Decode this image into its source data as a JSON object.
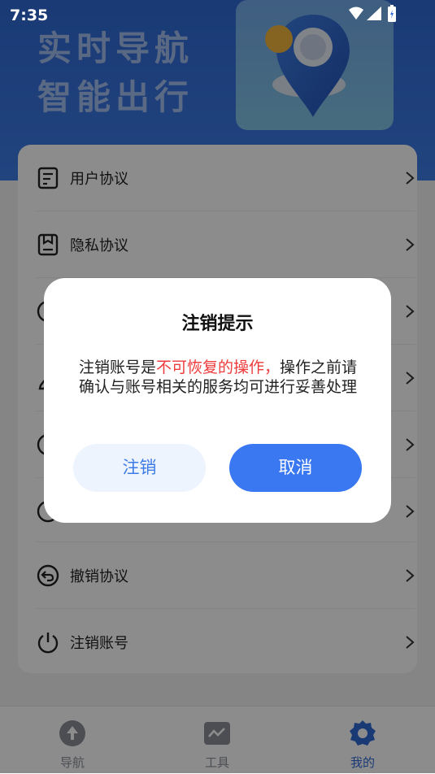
{
  "status_bar": {
    "time": "7:35"
  },
  "hero": {
    "line1": "实时导航",
    "line2": "智能出行"
  },
  "menu": {
    "items": [
      {
        "label": "用户协议",
        "icon": "document-icon"
      },
      {
        "label": "隐私协议",
        "icon": "privacy-book-icon"
      },
      {
        "label": "",
        "icon": "circle-icon"
      },
      {
        "label": "",
        "icon": "pen-icon"
      },
      {
        "label": "",
        "icon": "circle-icon"
      },
      {
        "label": "",
        "icon": "circle-icon"
      },
      {
        "label": "撤销协议",
        "icon": "revoke-icon"
      },
      {
        "label": "注销账号",
        "icon": "power-icon"
      }
    ]
  },
  "dialog": {
    "title": "注销提示",
    "message_prefix": "注销账号是",
    "message_warning": "不可恢复的操作，",
    "message_suffix": "操作之前请确认与账号相关的服务均可进行妥善处理",
    "confirm_label": "注销",
    "cancel_label": "取消",
    "warning_color": "#ee3b3b"
  },
  "tabbar": {
    "tabs": [
      {
        "label": "导航",
        "icon": "navigation-arrow-icon"
      },
      {
        "label": "工具",
        "icon": "tools-icon"
      },
      {
        "label": "我的",
        "icon": "gear-icon",
        "active": true
      }
    ]
  },
  "colors": {
    "accent": "#3a78f2",
    "hero": "#2f6ad6"
  }
}
